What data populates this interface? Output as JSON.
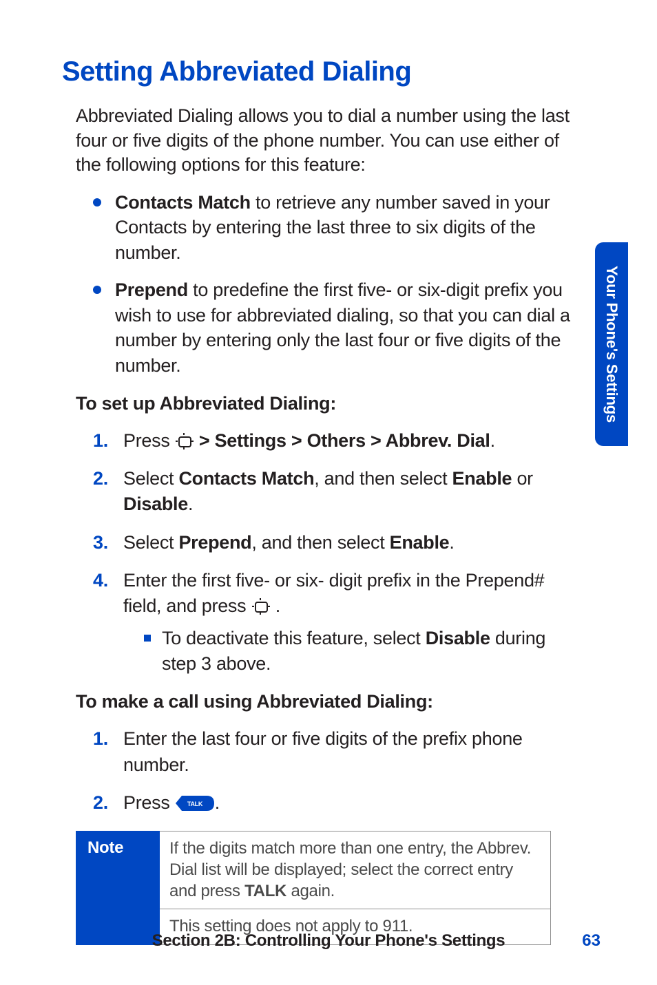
{
  "title": "Setting Abbreviated Dialing",
  "intro": "Abbreviated Dialing allows you to dial a number using the last four or five digits of the phone number. You can use either of the following options for this feature:",
  "features": [
    {
      "term": "Contacts Match",
      "desc": " to retrieve any number saved in your Contacts by entering the last three to six digits of the number."
    },
    {
      "term": "Prepend",
      "desc": " to predefine the first five- or six-digit prefix you wish to use for abbreviated dialing, so that you can dial a number by entering only the last four or five digits of the number."
    }
  ],
  "subhead1": "To set up Abbreviated Dialing:",
  "steps1": {
    "s1": {
      "pre": "Press ",
      "bold": " > Settings > Others > Abbrev. Dial",
      "post": "."
    },
    "s2": {
      "a": "Select ",
      "b": "Contacts Match",
      "c": ", and then select ",
      "d": "Enable",
      "e": " or ",
      "f": "Disable",
      "g": "."
    },
    "s3": {
      "a": "Select ",
      "b": "Prepend",
      "c": ", and then select ",
      "d": "Enable",
      "e": "."
    },
    "s4": {
      "a": "Enter the first five- or six- digit prefix in the Prepend# field, and press ",
      "b": " .",
      "sub": {
        "a": "To deactivate this feature, select ",
        "b": "Disable",
        "c": " during step 3 above."
      }
    }
  },
  "subhead2": "To make a call using Abbreviated Dialing:",
  "steps2": {
    "s1": "Enter the last four or five digits of the prefix phone number.",
    "s2": {
      "a": "Press ",
      "b": "."
    }
  },
  "note": {
    "label": "Note",
    "row1a": "If the digits match more than one entry, the Abbrev. Dial list will be displayed; select the correct entry and press ",
    "row1b": "TALK",
    "row1c": " again.",
    "row2": "This setting does not apply to 911."
  },
  "sidetab": "Your Phone's Settings",
  "footer": {
    "text": "Section 2B: Controlling Your Phone's Settings",
    "page": "63"
  },
  "talk_label": "TALK"
}
